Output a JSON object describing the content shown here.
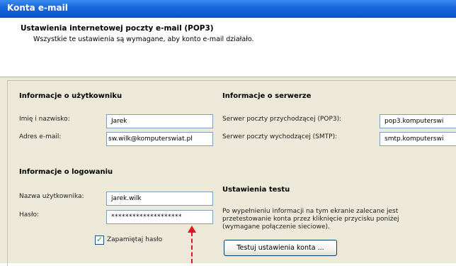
{
  "window": {
    "title": "Konta e-mail"
  },
  "header": {
    "title": "Ustawienia internetowej poczty e-mail (POP3)",
    "subtitle": "Wszystkie te ustawienia są wymagane, aby konto e-mail działało."
  },
  "user_info": {
    "heading": "Informacje o użytkowniku",
    "name_label": "Imię i nazwisko:",
    "name_value": "Jarek",
    "email_label": "Adres e-mail:",
    "email_value": "sw.wilk@komputerswiat.pl"
  },
  "server_info": {
    "heading": "Informacje o serwerze",
    "incoming_label": "Serwer poczty przychodzącej (POP3):",
    "incoming_value": "pop3.komputerswi",
    "outgoing_label": "Serwer poczty wychodzącej (SMTP):",
    "outgoing_value": "smtp.komputerswi"
  },
  "login_info": {
    "heading": "Informacje o logowaniu",
    "username_label": "Nazwa użytkownika:",
    "username_value": "jarek.wilk",
    "password_label": "Hasło:",
    "password_value": "********************",
    "remember_label": "Zapamiętaj hasło",
    "remember_checked": true
  },
  "test_settings": {
    "heading": "Ustawienia testu",
    "description": "Po wypełnieniu informacji na tym ekranie zalecane jest przetestowanie konta przez kliknięcie przycisku poniżej (wymagane połączenie sieciowe).",
    "button_label": "Testuj ustawienia konta ..."
  },
  "colors": {
    "title_bar": "#1a66db",
    "dialog_bg": "#ece9d8",
    "annotation_arrow": "#e3141a"
  }
}
